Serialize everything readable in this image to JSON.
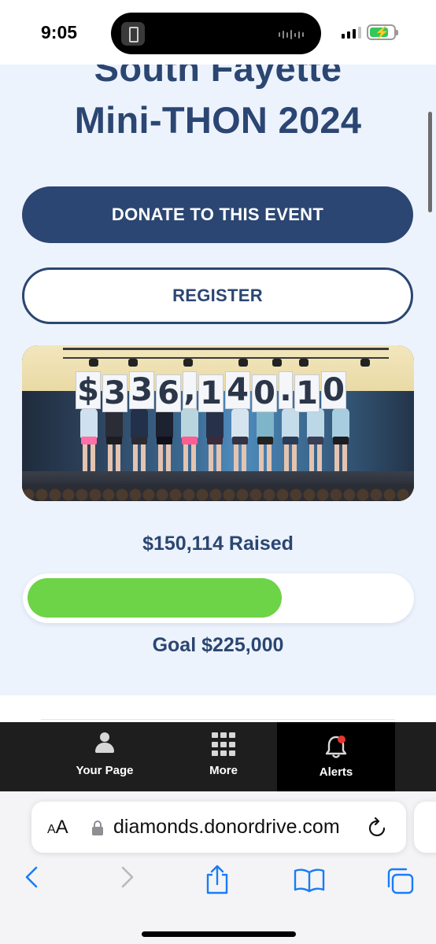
{
  "status_bar": {
    "time": "9:05",
    "battery_level": 0.7,
    "signal_bars": 3,
    "signal_bars_max": 4
  },
  "event": {
    "title_line1": "South Fayette",
    "title_line2": "Mini-THON 2024",
    "donate_label": "DONATE TO THIS EVENT",
    "register_label": "REGISTER",
    "photo_sign_characters": [
      "$",
      "3",
      "3",
      "6",
      ",",
      "1",
      "4",
      "0",
      ".",
      "1",
      "0"
    ]
  },
  "fundraising": {
    "raised_label": "$150,114 Raised",
    "goal_label": "Goal $225,000",
    "progress_fraction": 0.667,
    "progress_color": "#6dd347"
  },
  "bottom_nav": {
    "items": [
      {
        "label": "Your Page",
        "icon": "person-icon"
      },
      {
        "label": "More",
        "icon": "grid-icon"
      },
      {
        "label": "Alerts",
        "icon": "bell-icon"
      }
    ],
    "active": "Alerts"
  },
  "browser": {
    "text_size_label": "AA",
    "url": "diamonds.donordrive.com",
    "toolbar_icons": [
      "back-icon",
      "forward-icon",
      "share-icon",
      "bookmarks-icon",
      "tabs-icon"
    ]
  },
  "colors": {
    "brand": "#2b4672",
    "page_background": "#edf3fc",
    "accent_green": "#6dd347",
    "nav_background": "#1e1e1e",
    "alert_dot": "#e5372f",
    "safari_blue": "#1a7cf5"
  }
}
